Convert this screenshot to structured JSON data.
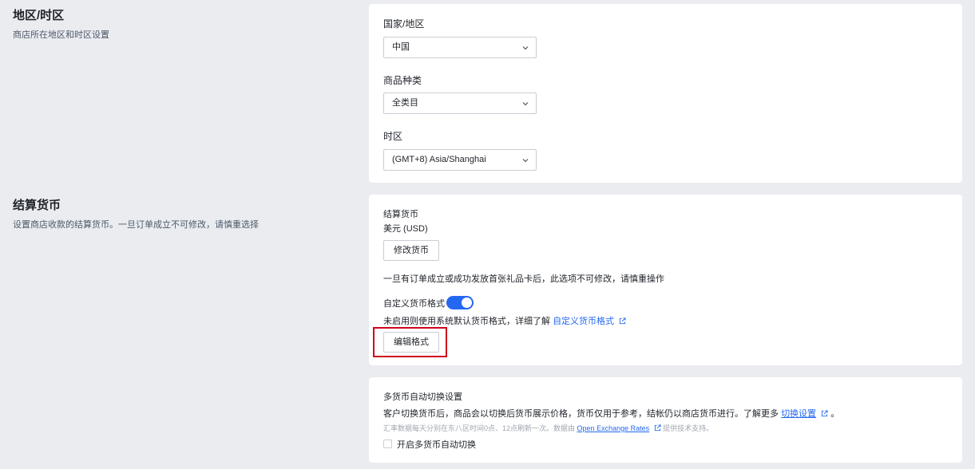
{
  "region_section": {
    "title": "地区/时区",
    "description": "商店所在地区和时区设置",
    "country_label": "国家/地区",
    "country_value": "中国",
    "category_label": "商品种类",
    "category_value": "全类目",
    "timezone_label": "时区",
    "timezone_value": "(GMT+8) Asia/Shanghai"
  },
  "currency_section": {
    "title": "结算货币",
    "description": "设置商店收款的结算货币。一旦订单成立不可修改，请慎重选择",
    "currency_label": "结算货币",
    "currency_value": "美元 (USD)",
    "change_button": "修改货币",
    "warning": "一旦有订单成立或成功发放首张礼品卡后，此选项不可修改，请慎重操作",
    "custom_format_label": "自定义货币格式",
    "custom_format_enabled": true,
    "custom_format_hint": "未启用则使用系统默认货币格式，详细了解",
    "custom_format_link": "自定义货币格式",
    "edit_format_button": "编辑格式"
  },
  "multi_currency": {
    "title": "多货币自动切换设置",
    "description": "客户切换货币后，商品会以切换后货币展示价格，货币仅用于参考，结帐仍以商店货币进行。了解更多",
    "learn_more_link": "切换设置",
    "description_end": "。",
    "rates_note_prefix": "汇率数据每天分别在东八区时间0点、12点刷新一次。数据由",
    "rates_link": "Open Exchange Rates",
    "rates_note_suffix": "提供技术支持。",
    "checkbox_label": "开启多货币自动切换",
    "checkbox_checked": false
  }
}
